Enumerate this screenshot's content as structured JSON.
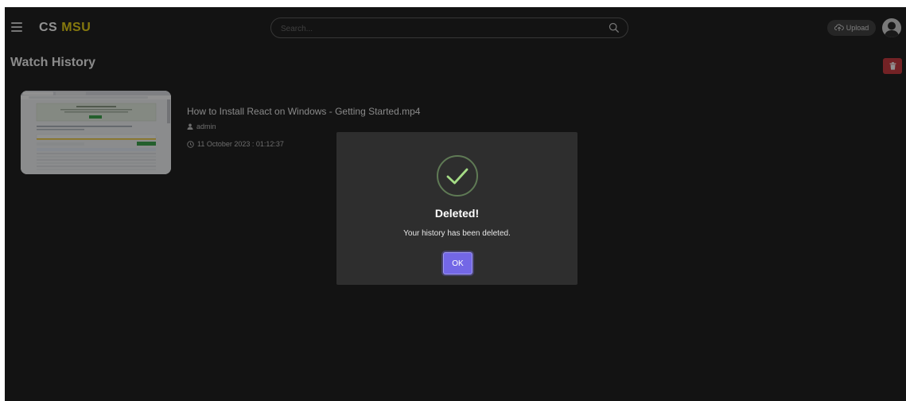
{
  "brand": {
    "part1": "CS",
    "part2": "MSU"
  },
  "search": {
    "placeholder": "Search..."
  },
  "header": {
    "upload_label": "Upload"
  },
  "page": {
    "title": "Watch History"
  },
  "history": [
    {
      "title": "How to Install React on Windows - Getting Started.mp4",
      "user": "admin",
      "date": "11 October 2023 : 01:12:37"
    }
  ],
  "modal": {
    "title": "Deleted!",
    "message": "Your history has been deleted.",
    "ok_label": "OK"
  },
  "colors": {
    "background": "#1a1a1a",
    "brand_accent": "#e9d10f",
    "delete": "#c8353b",
    "ok_button": "#7367e6",
    "success": "#a5dc86"
  },
  "icons": {
    "menu": "menu-icon",
    "search": "search-icon",
    "upload": "cloud-upload-icon",
    "avatar": "user-avatar-icon",
    "delete": "trash-icon",
    "user": "user-icon",
    "date": "clock-icon",
    "success": "checkmark-circle-icon"
  }
}
